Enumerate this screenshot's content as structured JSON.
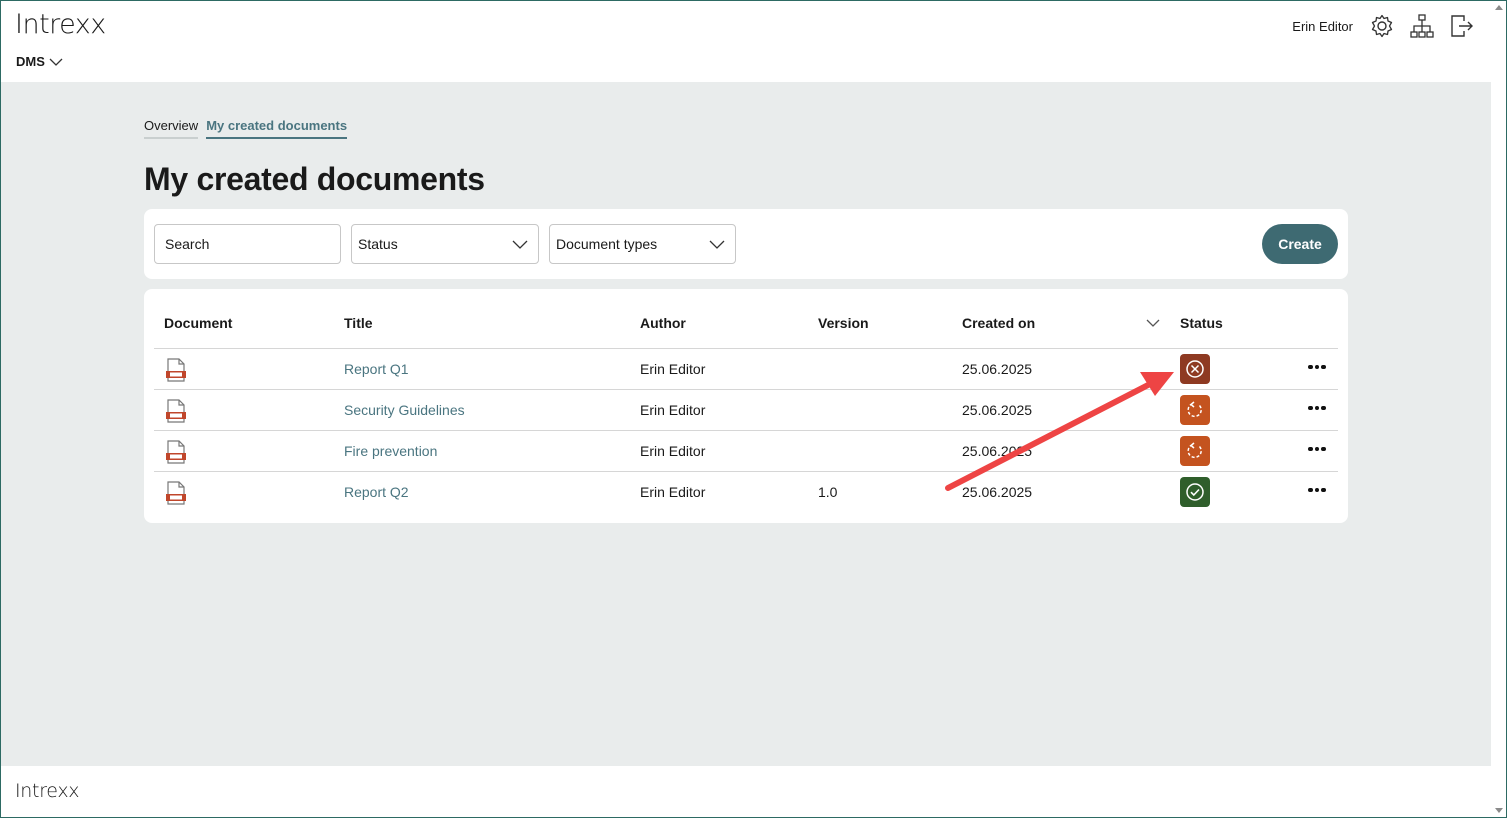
{
  "header": {
    "logo": "Intrexx",
    "app_menu": "DMS",
    "user_name": "Erin Editor",
    "icons": [
      "gear-icon",
      "sitemap-icon",
      "logout-icon"
    ]
  },
  "tabs": [
    {
      "label": "Overview",
      "active": false
    },
    {
      "label": "My created documents",
      "active": true
    }
  ],
  "page_title": "My created documents",
  "filters": {
    "search_placeholder": "Search",
    "status_label": "Status",
    "doctype_label": "Document types",
    "create_label": "Create"
  },
  "table": {
    "columns": [
      "Document",
      "Title",
      "Author",
      "Version",
      "Created on",
      "Status"
    ],
    "sort_column": "Created on",
    "rows": [
      {
        "title": "Report Q1",
        "author": "Erin Editor",
        "version": "",
        "created": "25.06.2025",
        "status": "rejected",
        "status_color": "#8e3a22"
      },
      {
        "title": "Security Guidelines",
        "author": "Erin Editor",
        "version": "",
        "created": "25.06.2025",
        "status": "in-progress",
        "status_color": "#c4531f"
      },
      {
        "title": "Fire prevention",
        "author": "Erin Editor",
        "version": "",
        "created": "25.06.2025",
        "status": "in-progress",
        "status_color": "#c4531f"
      },
      {
        "title": "Report Q2",
        "author": "Erin Editor",
        "version": "1.0",
        "created": "25.06.2025",
        "status": "approved",
        "status_color": "#2f5e2b"
      }
    ]
  },
  "footer": {
    "logo": "Intrexx"
  },
  "colors": {
    "accent": "#3e6a72",
    "link": "#4a7580",
    "annotation_arrow": "#ee4444",
    "doc_icon": "#c0462b"
  }
}
